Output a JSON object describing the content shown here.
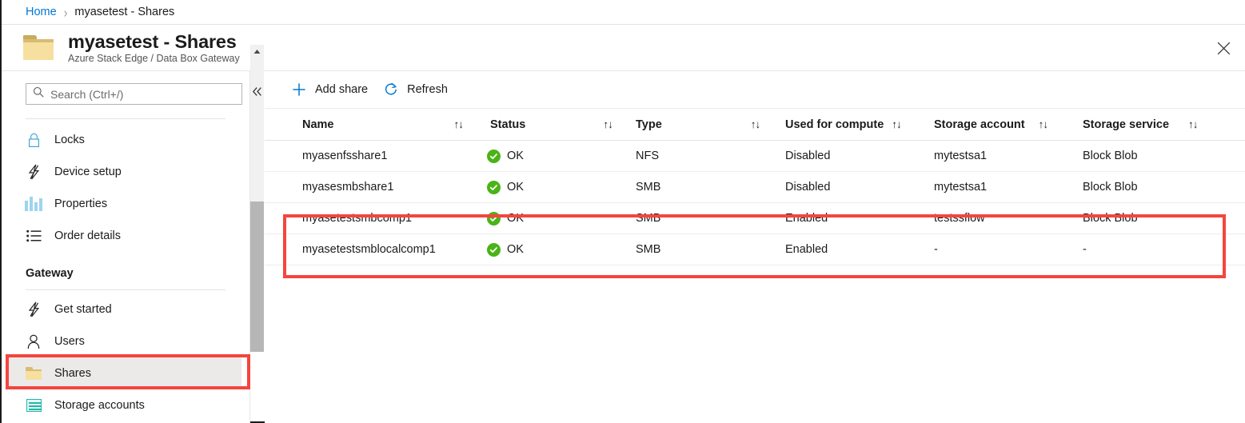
{
  "breadcrumb": {
    "home": "Home",
    "separator": "›",
    "current": "myasetest - Shares"
  },
  "header": {
    "title": "myasetest - Shares",
    "subtitle": "Azure Stack Edge / Data Box Gateway",
    "folder_icon": "folder-icon",
    "close_icon": "close-icon",
    "close_label": "✕"
  },
  "sidebar": {
    "search": {
      "placeholder": "Search (Ctrl+/)",
      "value": "",
      "icon": "search-icon"
    },
    "collapse": {
      "icon": "chevron-double-left-icon",
      "label": "«"
    },
    "items": [
      {
        "label": "Locks",
        "icon": "lock-icon",
        "selected": false
      },
      {
        "label": "Device setup",
        "icon": "lightning-bolt-icon",
        "selected": false
      },
      {
        "label": "Properties",
        "icon": "sliders-icon",
        "selected": false
      },
      {
        "label": "Order details",
        "icon": "list-icon",
        "selected": false
      }
    ],
    "group": {
      "title": "Gateway",
      "items": [
        {
          "label": "Get started",
          "icon": "lightning-bolt-icon",
          "selected": false
        },
        {
          "label": "Users",
          "icon": "person-icon",
          "selected": false
        },
        {
          "label": "Shares",
          "icon": "folder-icon",
          "selected": true
        },
        {
          "label": "Storage accounts",
          "icon": "storage-account-icon",
          "selected": false
        }
      ]
    },
    "scrollbar": {
      "up_arrow": "▲"
    }
  },
  "toolbar": {
    "add_share": {
      "label": "Add share",
      "icon": "plus-icon"
    },
    "refresh": {
      "label": "Refresh",
      "icon": "refresh-icon"
    }
  },
  "table": {
    "sort_icon": "↑↓",
    "columns": [
      {
        "label": "Name",
        "sortable": true
      },
      {
        "label": "Status",
        "sortable": true
      },
      {
        "label": "Type",
        "sortable": true
      },
      {
        "label": "Used for compute",
        "sortable": true
      },
      {
        "label": "Storage account",
        "sortable": true
      },
      {
        "label": "Storage service",
        "sortable": true
      }
    ],
    "rows": [
      {
        "name": "myasenfsshare1",
        "status": "OK",
        "status_icon": "check-circle-icon",
        "type": "NFS",
        "used_for_compute": "Disabled",
        "storage_account": "mytestsa1",
        "storage_service": "Block Blob"
      },
      {
        "name": "myasesmbshare1",
        "status": "OK",
        "status_icon": "check-circle-icon",
        "type": "SMB",
        "used_for_compute": "Disabled",
        "storage_account": "mytestsa1",
        "storage_service": "Block Blob"
      },
      {
        "name": "myasetestsmbcomp1",
        "status": "OK",
        "status_icon": "check-circle-icon",
        "type": "SMB",
        "used_for_compute": "Enabled",
        "storage_account": "testssflow",
        "storage_service": "Block Blob"
      },
      {
        "name": "myasetestsmblocalcomp1",
        "status": "OK",
        "status_icon": "check-circle-icon",
        "type": "SMB",
        "used_for_compute": "Enabled",
        "storage_account": "-",
        "storage_service": "-"
      }
    ]
  },
  "annotations": {
    "highlight_color": "#f4453f",
    "boxes": [
      {
        "name": "shares-nav-highlight"
      },
      {
        "name": "compute-rows-highlight"
      }
    ]
  },
  "colors": {
    "accent": "#0078d4",
    "link": "#0078d4",
    "status_ok": "#4ab317",
    "highlight": "#f4453f",
    "folder": "#f6df9f",
    "storage_teal": "#1fb8ab"
  }
}
